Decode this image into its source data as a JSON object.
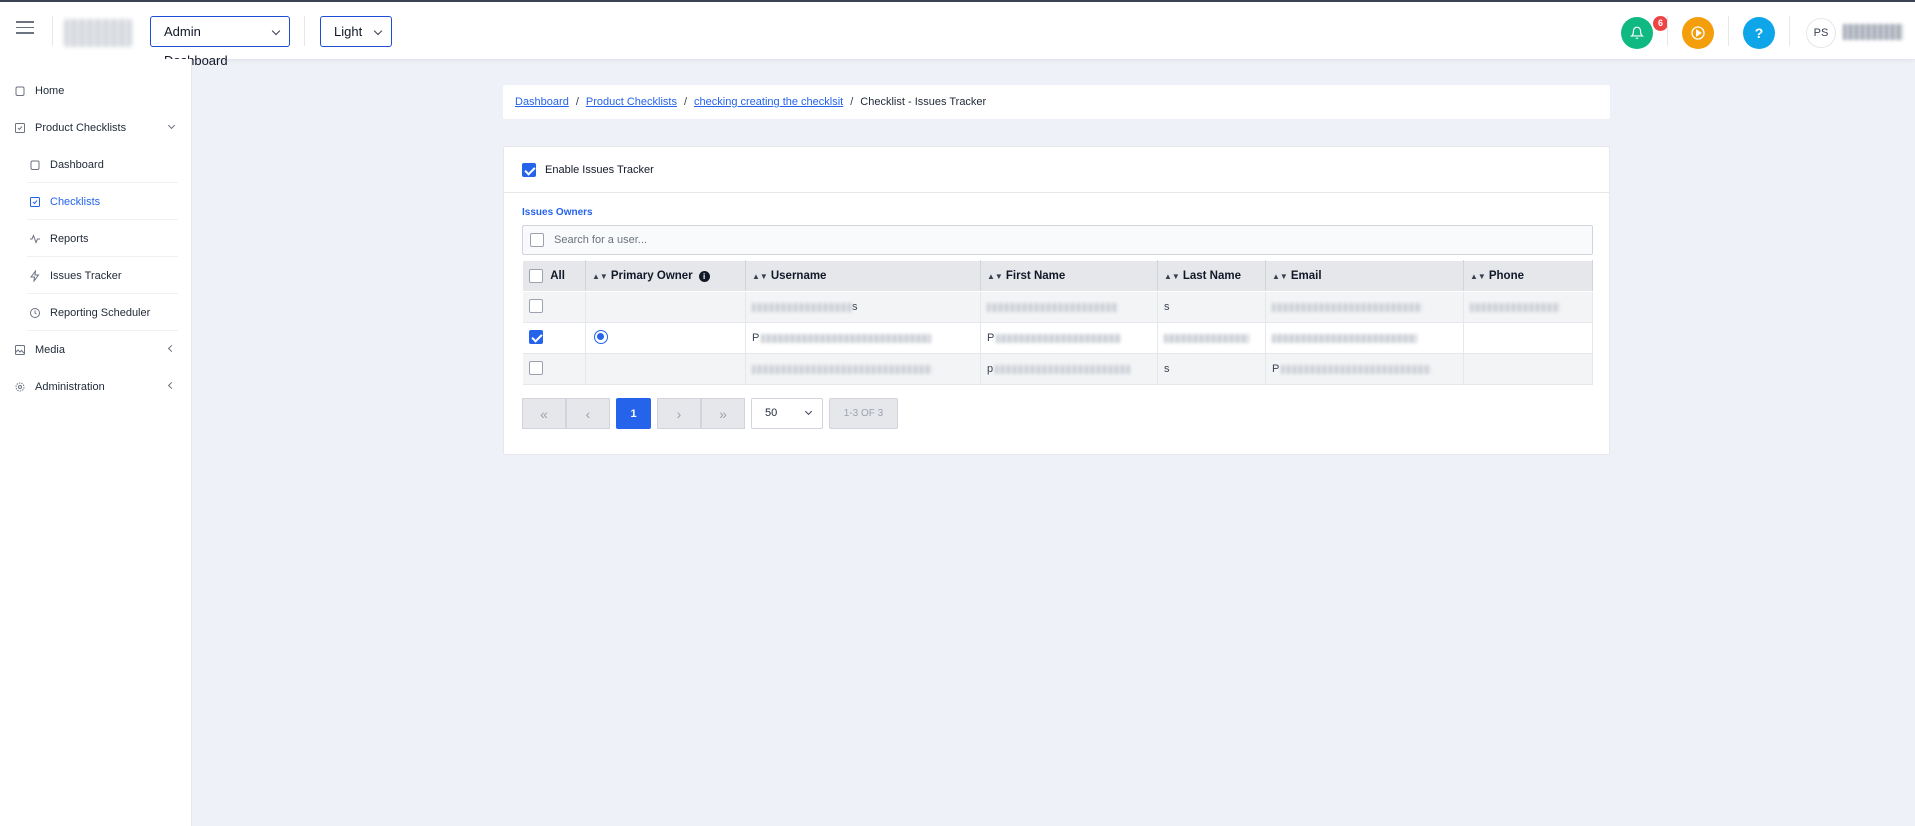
{
  "header": {
    "dashboard_select": "Admin Dashboard",
    "theme_select": "Light",
    "notification_count": "6",
    "help_label": "?",
    "user_initials": "PS"
  },
  "sidebar": {
    "items": [
      {
        "label": "Home"
      },
      {
        "label": "Product Checklists"
      },
      {
        "label": "Dashboard"
      },
      {
        "label": "Checklists"
      },
      {
        "label": "Reports"
      },
      {
        "label": "Issues Tracker"
      },
      {
        "label": "Reporting Scheduler"
      },
      {
        "label": "Media"
      },
      {
        "label": "Administration"
      }
    ]
  },
  "breadcrumb": {
    "items": [
      "Dashboard",
      "Product Checklists",
      "checking creating the checklsit"
    ],
    "current": "Checklist - Issues Tracker",
    "separator": "/"
  },
  "tracker": {
    "enable_label": "Enable Issues Tracker",
    "enabled": true,
    "owners_label": "Issues Owners",
    "search_placeholder": "Search for a user..."
  },
  "table": {
    "columns": [
      "All",
      "Primary Owner",
      "Username",
      "First Name",
      "Last Name",
      "Email",
      "Phone"
    ],
    "rows": [
      {
        "selected": false,
        "primary": false,
        "username_visible": "s",
        "first_visible": "",
        "last_visible": "s",
        "email_visible": "",
        "phone_visible": ""
      },
      {
        "selected": true,
        "primary": true,
        "username_visible": "P",
        "first_visible": "P",
        "last_visible": "",
        "email_visible": "",
        "phone_visible": ""
      },
      {
        "selected": false,
        "primary": false,
        "username_visible": "",
        "first_visible": "p",
        "last_visible": "s",
        "email_visible": "P",
        "phone_visible": ""
      }
    ]
  },
  "pagination": {
    "current_page": "1",
    "page_size": "50",
    "range_text": "1-3 OF 3"
  },
  "colors": {
    "accent": "#2563eb",
    "bell": "#10b981",
    "play": "#f59e0b",
    "help": "#0ea5e9",
    "badge": "#ef4444"
  }
}
